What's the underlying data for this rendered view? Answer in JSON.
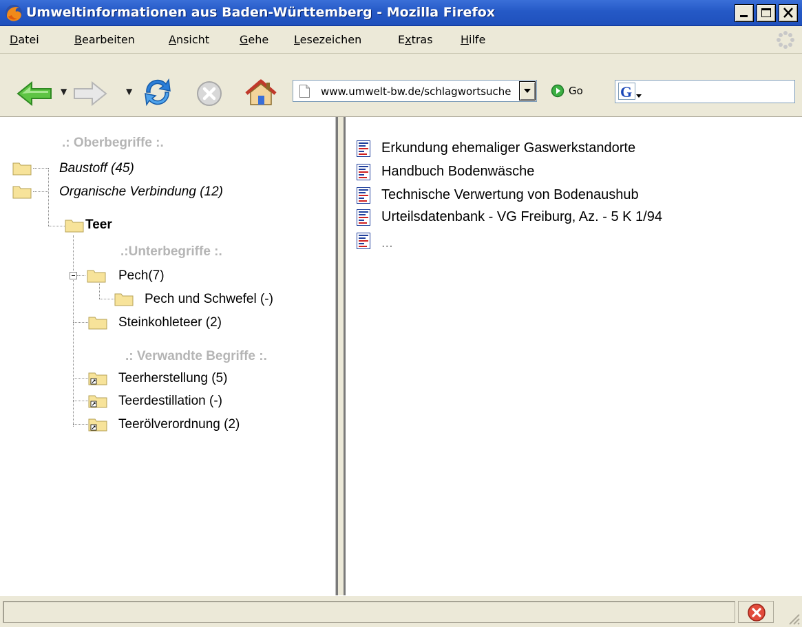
{
  "window": {
    "title": "Umweltinformationen aus Baden-Württemberg - Mozilla Firefox"
  },
  "menu": [
    {
      "accel": "D",
      "rest": "atei"
    },
    {
      "accel": "B",
      "rest": "earbeiten"
    },
    {
      "accel": "A",
      "rest": "nsicht"
    },
    {
      "accel": "G",
      "rest": "ehe"
    },
    {
      "accel": "L",
      "rest": "esezeichen"
    },
    {
      "pre": "E",
      "accel": "x",
      "rest": "tras"
    },
    {
      "accel": "H",
      "rest": "ilfe"
    }
  ],
  "toolbar": {
    "url": "www.umwelt-bw.de/schlagwortsuche",
    "go_label": "Go"
  },
  "tree": {
    "broader_header": ".: Oberbegriffe :.",
    "broader": [
      "Baustoff (45)",
      "Organische Verbindung (12)"
    ],
    "current": "Teer",
    "narrower_header": ".:Unterbegriffe :.",
    "narrower": [
      {
        "label": "Pech",
        "count": "(7)"
      },
      {
        "label": "Pech und Schwefel (-)"
      },
      {
        "label": "Steinkohleteer (2)"
      }
    ],
    "related_header": ".: Verwandte Begriffe :.",
    "related": [
      "Teerherstellung (5)",
      "Teerdestillation (-)",
      "Teerölverordnung (2)"
    ]
  },
  "documents": [
    "Erkundung ehemaliger Gaswerkstandorte",
    "Handbuch Bodenwäsche",
    "Technische Verwertung von Bodenaushub",
    "Urteilsdatenbank - VG Freiburg, Az. - 5 K 1/94",
    "..."
  ],
  "status": {
    "text": ""
  },
  "colors": {
    "titlebar": "#2559c6",
    "chrome": "#ece9d8",
    "header_gray": "#b5b5b5",
    "folder_yellow": "#f7e39a"
  }
}
